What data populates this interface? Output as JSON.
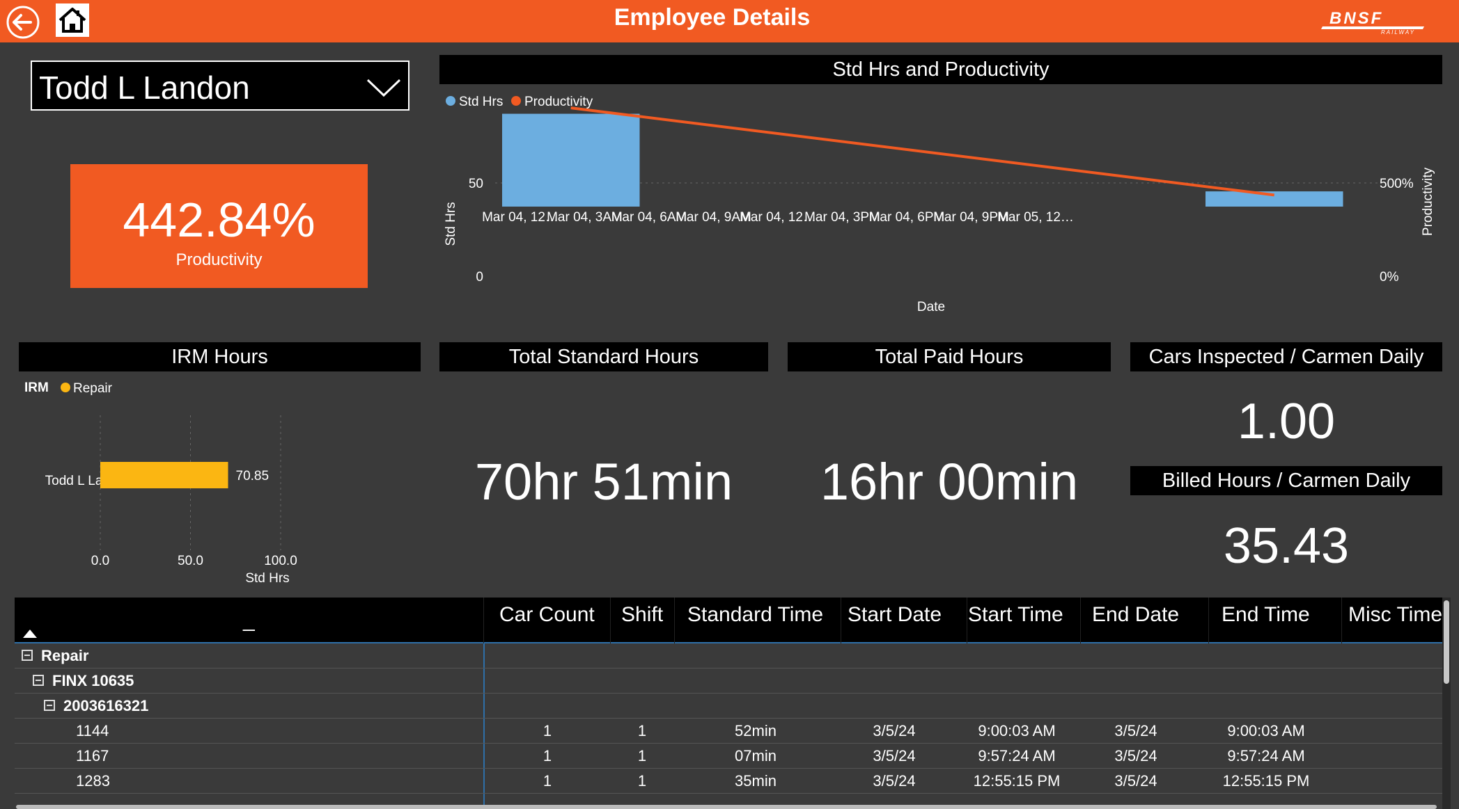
{
  "header": {
    "title": "Employee Details",
    "logo_text": "BNSF",
    "logo_subtext": "RAILWAY",
    "back_icon": "back-arrow-icon",
    "home_icon": "home-icon",
    "colors": {
      "bar": "#f15a22",
      "background": "#3a3a3a"
    }
  },
  "employee_select": {
    "value": "Todd L Landon"
  },
  "productivity_card": {
    "value": "442.84%",
    "label": "Productivity"
  },
  "std_hrs_chart": {
    "title": "Std Hrs and Productivity",
    "legend": [
      {
        "label": "Std Hrs",
        "color": "#6caee0"
      },
      {
        "label": "Productivity",
        "color": "#f15a22"
      }
    ],
    "x_title": "Date",
    "y_left_title": "Std Hrs",
    "y_right_title": "Productivity",
    "y_left_ticks": [
      "50",
      "0"
    ],
    "y_right_ticks": [
      "500%",
      "0%"
    ],
    "x_ticks": [
      "Mar 04, 12…",
      "Mar 04, 3AM",
      "Mar 04, 6AM",
      "Mar 04, 9AM",
      "Mar 04, 12…",
      "Mar 04, 3PM",
      "Mar 04, 6PM",
      "Mar 04, 9PM",
      "Mar 05, 12…"
    ]
  },
  "irm_chart": {
    "title": "IRM Hours",
    "legend_title": "IRM",
    "legend": [
      {
        "label": "Repair",
        "color": "#fbb612"
      }
    ],
    "category_label": "Todd L Lan…",
    "value_label": "70.85",
    "x_ticks": [
      "0.0",
      "50.0",
      "100.0"
    ],
    "x_title": "Std Hrs"
  },
  "total_standard_hours": {
    "title": "Total Standard Hours",
    "value": "70hr 51min"
  },
  "total_paid_hours": {
    "title": "Total Paid Hours",
    "value": "16hr 00min"
  },
  "cars_inspected": {
    "title": "Cars Inspected / Carmen Daily",
    "value": "1.00"
  },
  "billed_hours": {
    "title": "Billed Hours / Carmen Daily",
    "value": "35.43"
  },
  "table": {
    "first_col_header": "_",
    "columns": [
      "Car Count",
      "Shift",
      "Standard Time",
      "Start Date",
      "Start Time",
      "End Date",
      "End Time",
      "Misc Time"
    ],
    "groups": [
      {
        "label": "Repair"
      },
      {
        "label": "FINX 10635"
      },
      {
        "label": "2003616321"
      }
    ],
    "rows": [
      {
        "id": "1144",
        "car_count": "1",
        "shift": "1",
        "standard_time": "52min",
        "start_date": "3/5/24",
        "start_time": "9:00:03 AM",
        "end_date": "3/5/24",
        "end_time": "9:00:03 AM",
        "misc_time": ""
      },
      {
        "id": "1167",
        "car_count": "1",
        "shift": "1",
        "standard_time": "07min",
        "start_date": "3/5/24",
        "start_time": "9:57:24 AM",
        "end_date": "3/5/24",
        "end_time": "9:57:24 AM",
        "misc_time": ""
      },
      {
        "id": "1283",
        "car_count": "1",
        "shift": "1",
        "standard_time": "35min",
        "start_date": "3/5/24",
        "start_time": "12:55:15 PM",
        "end_date": "3/5/24",
        "end_time": "12:55:15 PM",
        "misc_time": ""
      }
    ]
  },
  "chart_data": [
    {
      "type": "bar",
      "title": "Std Hrs and Productivity",
      "xlabel": "Date",
      "ylabel": "Std Hrs",
      "y2label": "Productivity",
      "categories": [
        "Mar 04, 12…",
        "Mar 05, 12…"
      ],
      "series": [
        {
          "name": "Std Hrs",
          "type": "bar",
          "values": [
            61,
            10
          ]
        },
        {
          "name": "Productivity",
          "type": "line",
          "axis": "right",
          "values": [
            770,
            90
          ]
        }
      ],
      "ylim": [
        0,
        80
      ],
      "y2lim": [
        0,
        950
      ],
      "grid": true,
      "legend": "top-left"
    },
    {
      "type": "bar",
      "orientation": "horizontal",
      "title": "IRM Hours",
      "xlabel": "Std Hrs",
      "categories": [
        "Todd L Lan…"
      ],
      "series": [
        {
          "name": "Repair",
          "values": [
            70.85
          ]
        }
      ],
      "xlim": [
        0,
        100
      ],
      "grid": true,
      "legend": "top-left"
    }
  ]
}
